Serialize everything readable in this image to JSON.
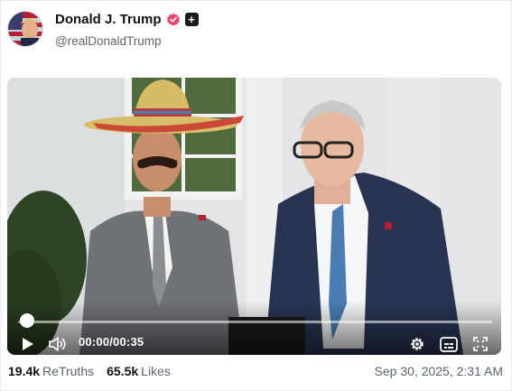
{
  "post": {
    "author": {
      "display_name": "Donald J. Trump",
      "handle": "@realDonaldTrump",
      "verified_icon": "verified-badge-icon",
      "follow_icon": "plus-icon",
      "follow_symbol": "+"
    },
    "video": {
      "time_display": "00:00/00:35",
      "progress": 0.0,
      "icons": [
        "play-icon",
        "volume-icon",
        "settings-gear-icon",
        "captions-icon",
        "fullscreen-icon"
      ]
    },
    "stats": {
      "retruths_count": "19.4k",
      "retruths_label": "ReTruths",
      "likes_count": "65.5k",
      "likes_label": "Likes"
    },
    "timestamp": "Sep 30, 2025, 2:31 AM"
  },
  "colors": {
    "verified": "#e8456a",
    "text_secondary": "#5b6470",
    "text_primary": "#111111"
  }
}
